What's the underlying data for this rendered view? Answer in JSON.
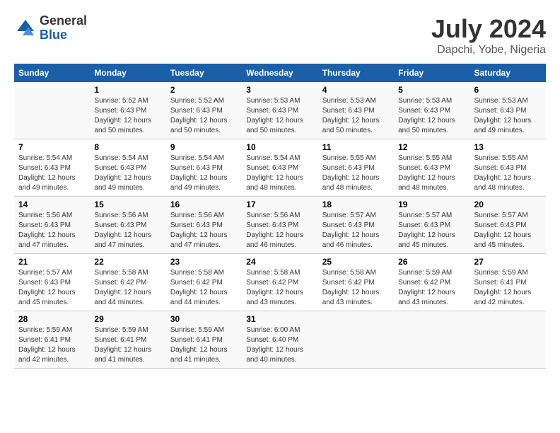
{
  "header": {
    "logo_general": "General",
    "logo_blue": "Blue",
    "month_year": "July 2024",
    "location": "Dapchi, Yobe, Nigeria"
  },
  "days_of_week": [
    "Sunday",
    "Monday",
    "Tuesday",
    "Wednesday",
    "Thursday",
    "Friday",
    "Saturday"
  ],
  "weeks": [
    [
      {
        "day": "",
        "info": ""
      },
      {
        "day": "1",
        "info": "Sunrise: 5:52 AM\nSunset: 6:43 PM\nDaylight: 12 hours\nand 50 minutes."
      },
      {
        "day": "2",
        "info": "Sunrise: 5:52 AM\nSunset: 6:43 PM\nDaylight: 12 hours\nand 50 minutes."
      },
      {
        "day": "3",
        "info": "Sunrise: 5:53 AM\nSunset: 6:43 PM\nDaylight: 12 hours\nand 50 minutes."
      },
      {
        "day": "4",
        "info": "Sunrise: 5:53 AM\nSunset: 6:43 PM\nDaylight: 12 hours\nand 50 minutes."
      },
      {
        "day": "5",
        "info": "Sunrise: 5:53 AM\nSunset: 6:43 PM\nDaylight: 12 hours\nand 50 minutes."
      },
      {
        "day": "6",
        "info": "Sunrise: 5:53 AM\nSunset: 6:43 PM\nDaylight: 12 hours\nand 49 minutes."
      }
    ],
    [
      {
        "day": "7",
        "info": "Sunrise: 5:54 AM\nSunset: 6:43 PM\nDaylight: 12 hours\nand 49 minutes."
      },
      {
        "day": "8",
        "info": "Sunrise: 5:54 AM\nSunset: 6:43 PM\nDaylight: 12 hours\nand 49 minutes."
      },
      {
        "day": "9",
        "info": "Sunrise: 5:54 AM\nSunset: 6:43 PM\nDaylight: 12 hours\nand 49 minutes."
      },
      {
        "day": "10",
        "info": "Sunrise: 5:54 AM\nSunset: 6:43 PM\nDaylight: 12 hours\nand 48 minutes."
      },
      {
        "day": "11",
        "info": "Sunrise: 5:55 AM\nSunset: 6:43 PM\nDaylight: 12 hours\nand 48 minutes."
      },
      {
        "day": "12",
        "info": "Sunrise: 5:55 AM\nSunset: 6:43 PM\nDaylight: 12 hours\nand 48 minutes."
      },
      {
        "day": "13",
        "info": "Sunrise: 5:55 AM\nSunset: 6:43 PM\nDaylight: 12 hours\nand 48 minutes."
      }
    ],
    [
      {
        "day": "14",
        "info": "Sunrise: 5:56 AM\nSunset: 6:43 PM\nDaylight: 12 hours\nand 47 minutes."
      },
      {
        "day": "15",
        "info": "Sunrise: 5:56 AM\nSunset: 6:43 PM\nDaylight: 12 hours\nand 47 minutes."
      },
      {
        "day": "16",
        "info": "Sunrise: 5:56 AM\nSunset: 6:43 PM\nDaylight: 12 hours\nand 47 minutes."
      },
      {
        "day": "17",
        "info": "Sunrise: 5:56 AM\nSunset: 6:43 PM\nDaylight: 12 hours\nand 46 minutes."
      },
      {
        "day": "18",
        "info": "Sunrise: 5:57 AM\nSunset: 6:43 PM\nDaylight: 12 hours\nand 46 minutes."
      },
      {
        "day": "19",
        "info": "Sunrise: 5:57 AM\nSunset: 6:43 PM\nDaylight: 12 hours\nand 45 minutes."
      },
      {
        "day": "20",
        "info": "Sunrise: 5:57 AM\nSunset: 6:43 PM\nDaylight: 12 hours\nand 45 minutes."
      }
    ],
    [
      {
        "day": "21",
        "info": "Sunrise: 5:57 AM\nSunset: 6:43 PM\nDaylight: 12 hours\nand 45 minutes."
      },
      {
        "day": "22",
        "info": "Sunrise: 5:58 AM\nSunset: 6:42 PM\nDaylight: 12 hours\nand 44 minutes."
      },
      {
        "day": "23",
        "info": "Sunrise: 5:58 AM\nSunset: 6:42 PM\nDaylight: 12 hours\nand 44 minutes."
      },
      {
        "day": "24",
        "info": "Sunrise: 5:58 AM\nSunset: 6:42 PM\nDaylight: 12 hours\nand 43 minutes."
      },
      {
        "day": "25",
        "info": "Sunrise: 5:58 AM\nSunset: 6:42 PM\nDaylight: 12 hours\nand 43 minutes."
      },
      {
        "day": "26",
        "info": "Sunrise: 5:59 AM\nSunset: 6:42 PM\nDaylight: 12 hours\nand 43 minutes."
      },
      {
        "day": "27",
        "info": "Sunrise: 5:59 AM\nSunset: 6:41 PM\nDaylight: 12 hours\nand 42 minutes."
      }
    ],
    [
      {
        "day": "28",
        "info": "Sunrise: 5:59 AM\nSunset: 6:41 PM\nDaylight: 12 hours\nand 42 minutes."
      },
      {
        "day": "29",
        "info": "Sunrise: 5:59 AM\nSunset: 6:41 PM\nDaylight: 12 hours\nand 41 minutes."
      },
      {
        "day": "30",
        "info": "Sunrise: 5:59 AM\nSunset: 6:41 PM\nDaylight: 12 hours\nand 41 minutes."
      },
      {
        "day": "31",
        "info": "Sunrise: 6:00 AM\nSunset: 6:40 PM\nDaylight: 12 hours\nand 40 minutes."
      },
      {
        "day": "",
        "info": ""
      },
      {
        "day": "",
        "info": ""
      },
      {
        "day": "",
        "info": ""
      }
    ]
  ]
}
